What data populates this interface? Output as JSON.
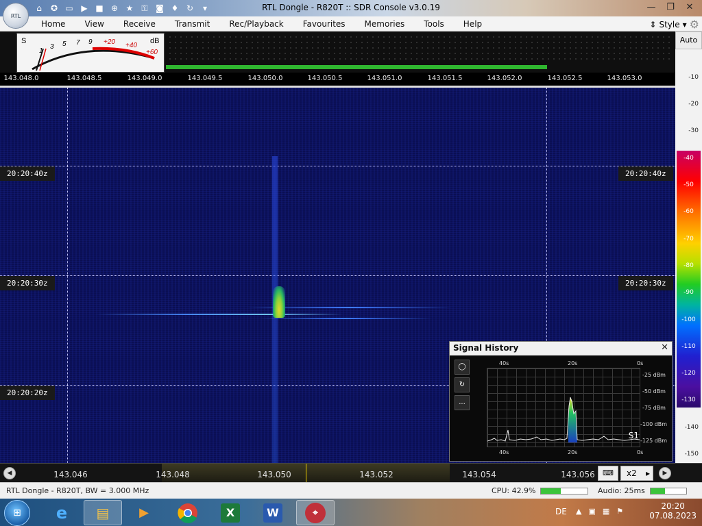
{
  "window": {
    "title": "RTL Dongle - R820T :: SDR Console v3.0.19",
    "app_button_label": "RTL"
  },
  "quick_access": [
    "home-icon",
    "lifebuoy-icon",
    "folder-icon",
    "play-icon",
    "stop-icon",
    "add-icon",
    "star-icon",
    "lock-icon",
    "camera-icon",
    "drop-icon",
    "refresh-icon",
    "expand-icon"
  ],
  "menu": {
    "items": [
      "Home",
      "View",
      "Receive",
      "Transmit",
      "Rec/Playback",
      "Favourites",
      "Memories",
      "Tools",
      "Help"
    ],
    "style_label": "Style"
  },
  "meter": {
    "s_label": "S",
    "db_label": "dB",
    "scale": [
      "1",
      "3",
      "5",
      "7",
      "9",
      "+20",
      "+40",
      "+60"
    ]
  },
  "auto_label": "Auto",
  "ruler": {
    "ticks": [
      "143.048.0",
      "143.048.5",
      "143.049.0",
      "143.049.5",
      "143.050.0",
      "143.050.5",
      "143.051.0",
      "143.051.5",
      "143.052.0",
      "143.052.5",
      "143.053.0"
    ]
  },
  "waterfall": {
    "time_labels": [
      "20:20:40z",
      "20:20:30z",
      "20:20:20z"
    ]
  },
  "scale": {
    "upper": [
      "-10",
      "-20",
      "-30"
    ],
    "colorbar": [
      "-40",
      "-50",
      "-60",
      "-70",
      "-80",
      "-90",
      "-100",
      "-110",
      "-120",
      "-130"
    ],
    "lower": [
      "-140",
      "-150"
    ]
  },
  "signal_history": {
    "title": "Signal History",
    "time_top": [
      "40s",
      "20s",
      "0s"
    ],
    "time_bottom": [
      "40s",
      "20s",
      "0s"
    ],
    "db_labels": [
      "-25 dBm",
      "-50 dBm",
      "-75 dBm",
      "-100 dBm",
      "-125 dBm"
    ],
    "s_readout": "S1",
    "button_3_label": "..."
  },
  "tuning": {
    "freqs": [
      "143.046",
      "143.048",
      "143.050",
      "143.052",
      "143.054",
      "143.056"
    ],
    "zoom": "x2"
  },
  "status": {
    "device": "RTL Dongle - R820T, BW = 3.000 MHz",
    "cpu": "CPU: 42.9%",
    "cpu_level": 0.43,
    "audio": "Audio: 25ms",
    "audio_level": 0.4
  },
  "taskbar": {
    "apps": [
      "ie-icon",
      "explorer-icon",
      "media-player-icon",
      "chrome-icon",
      "excel-icon",
      "word-icon",
      "sdr-console-icon"
    ],
    "lang": "DE",
    "time": "20:20",
    "date": "07.08.2023"
  }
}
